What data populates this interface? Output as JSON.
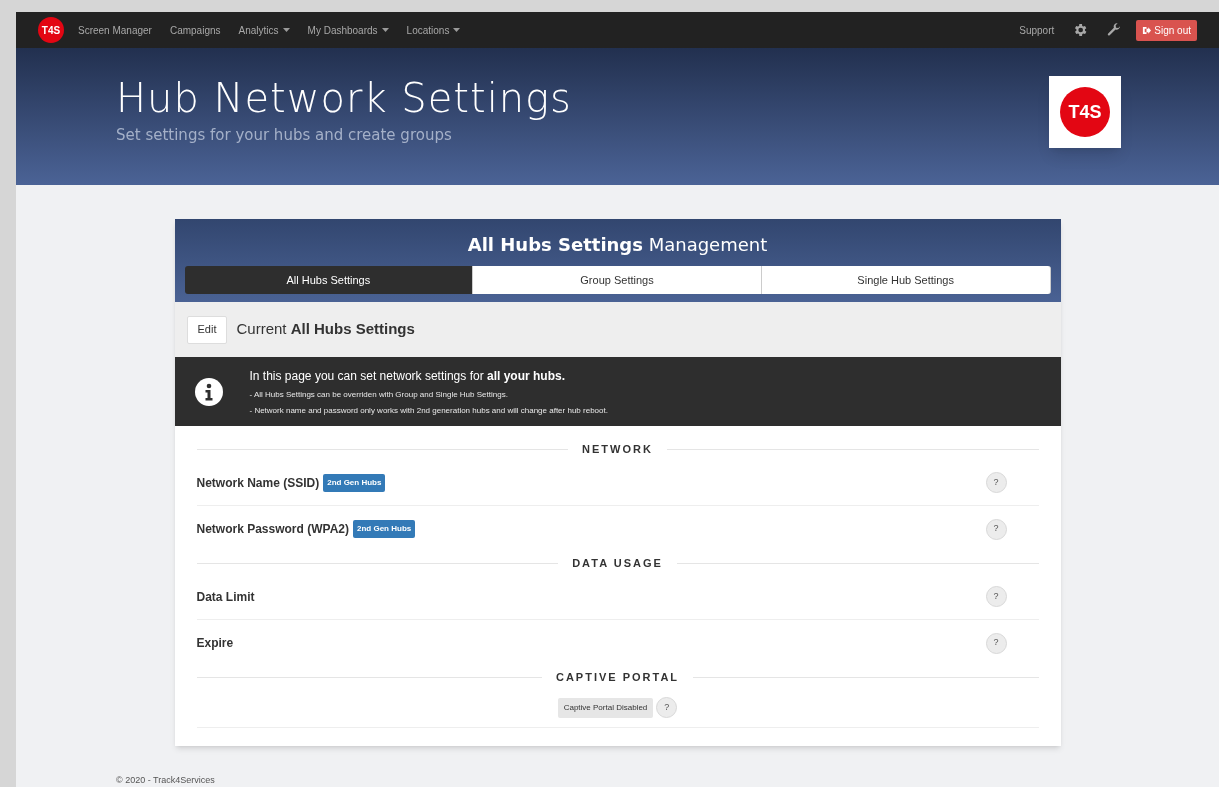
{
  "nav": {
    "logo": "T4S",
    "items": [
      {
        "label": "Screen Manager",
        "dropdown": false
      },
      {
        "label": "Campaigns",
        "dropdown": false
      },
      {
        "label": "Analytics",
        "dropdown": true
      },
      {
        "label": "My Dashboards",
        "dropdown": true
      },
      {
        "label": "Locations",
        "dropdown": true
      }
    ],
    "support": "Support",
    "sign_out": "Sign out"
  },
  "header": {
    "title": "Hub Network Settings",
    "subtitle": "Set settings for your hubs and create groups",
    "logo": "T4S"
  },
  "card": {
    "title": "**All Hubs Settings** Management",
    "tabs": [
      {
        "label": "All Hubs Settings",
        "selected": true
      },
      {
        "label": "Group Settings",
        "selected": false
      },
      {
        "label": "Single Hub Settings",
        "selected": false
      }
    ],
    "edit_button": "Edit",
    "current": "Current **All Hubs Settings**",
    "info": {
      "headline": "In this page you can set network settings for **all your hubs.**",
      "notes": [
        "- All Hubs Settings can be overriden with Group and Single Hub Settings.",
        "- Network name and password only works with 2nd generation hubs and will change after hub reboot."
      ]
    },
    "sections": [
      {
        "title": "NETWORK",
        "rows": [
          {
            "kind": "setting",
            "label": "Network Name (SSID)",
            "badge": "2nd Gen Hubs",
            "help": "?"
          },
          {
            "kind": "setting",
            "label": "Network Password (WPA2)",
            "badge": "2nd Gen Hubs",
            "help": "?"
          }
        ]
      },
      {
        "title": "DATA USAGE",
        "rows": [
          {
            "kind": "setting",
            "label": "Data Limit",
            "help": "?"
          },
          {
            "kind": "setting",
            "label": "Expire",
            "help": "?"
          }
        ]
      },
      {
        "title": "CAPTIVE PORTAL",
        "rows": [
          {
            "kind": "status",
            "label": "Captive Portal Disabled",
            "help": "?"
          }
        ]
      }
    ]
  },
  "footer": "© 2020 - Track4Services"
}
